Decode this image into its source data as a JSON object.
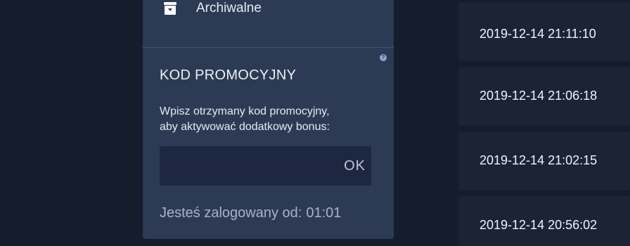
{
  "sidebar": {
    "archive": {
      "label": "Archiwalne",
      "icon": "archive-icon"
    },
    "promo": {
      "title": "KOD PROMOCYJNY",
      "help_icon": "?",
      "description_line1": "Wpisz otrzymany kod promocyjny,",
      "description_line2": "aby aktywować dodatkowy bonus:",
      "input_value": "",
      "input_placeholder": "",
      "ok_label": "OK"
    },
    "session": {
      "label": "Jesteś zalogowany od:",
      "value": "01:01"
    }
  },
  "timestamps": [
    "2019-12-14 21:11:10",
    "2019-12-14 21:06:18",
    "2019-12-14 21:02:15",
    "2019-12-14 20:56:02"
  ],
  "colors": {
    "page_background": "#151c2c",
    "panel_background": "#2c3a54",
    "input_background": "#1d2840",
    "list_item_background": "#1b2335",
    "text_primary": "#eef1f6",
    "text_muted": "#a9b3c6",
    "help_icon": "#8fa6d2"
  }
}
